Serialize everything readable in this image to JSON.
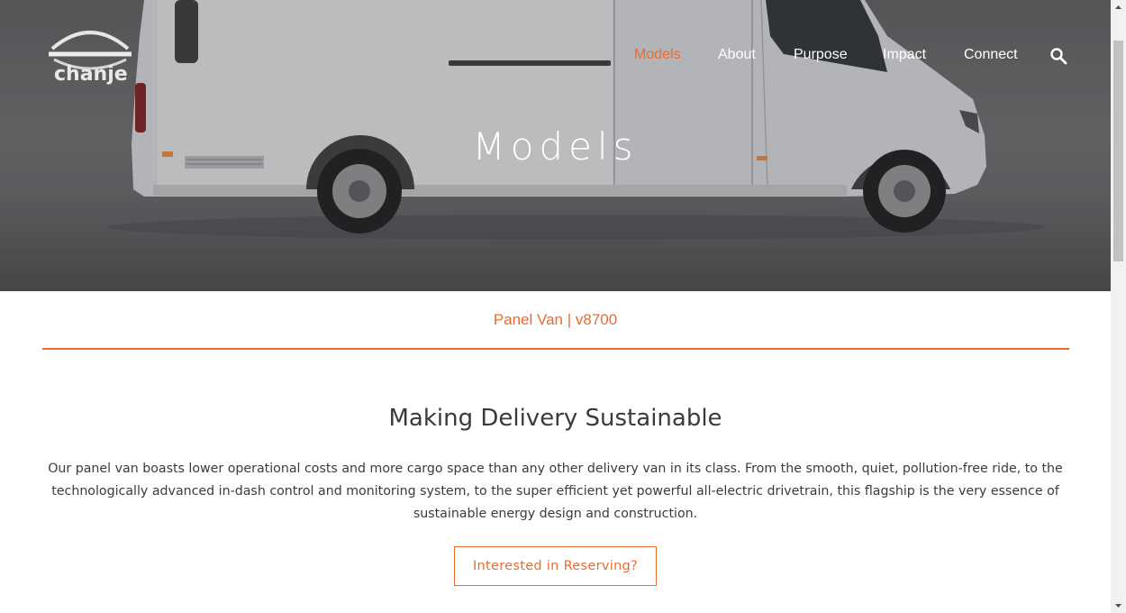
{
  "brand": {
    "logo_text": "chanje"
  },
  "nav": {
    "items": [
      {
        "label": "Models",
        "active": true
      },
      {
        "label": "About",
        "active": false
      },
      {
        "label": "Purpose",
        "active": false
      },
      {
        "label": "Impact",
        "active": false
      },
      {
        "label": "Connect",
        "active": false
      }
    ],
    "search_icon": "search-icon"
  },
  "hero": {
    "title": "Models"
  },
  "model": {
    "subheading": "Panel Van | v8700"
  },
  "section": {
    "title": "Making Delivery Sustainable",
    "body": "Our panel van boasts lower operational costs and more cargo space than any other delivery van in its class. From the smooth, quiet, pollution-free ride, to the technologically advanced in-dash control and monitoring system, to the super efficient yet powerful all-electric drivetrain, this flagship is the very essence of sustainable energy design and construction.",
    "cta_label": "Interested in Reserving?"
  },
  "colors": {
    "accent": "#ee6a2e",
    "text": "#3b3b3b",
    "hero_overlay": "#5f5f61"
  }
}
